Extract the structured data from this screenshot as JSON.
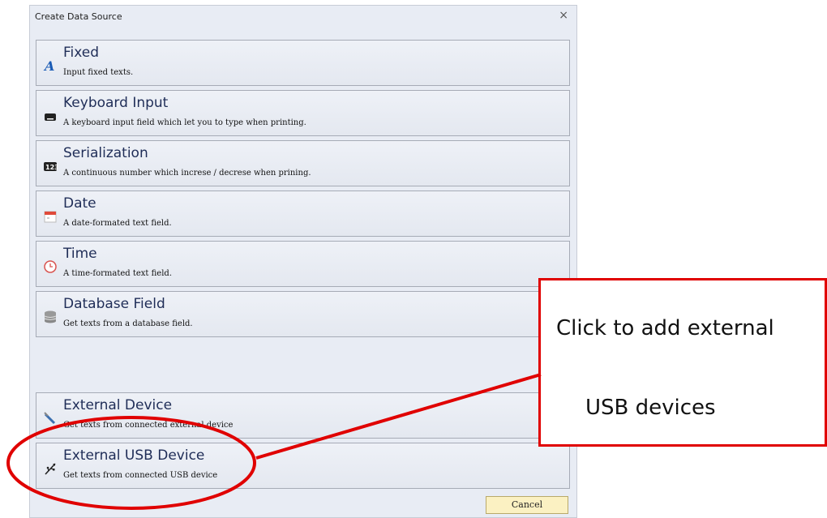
{
  "dialog": {
    "title": "Create Data Source",
    "close_glyph": "×",
    "items": [
      {
        "label": "Fixed",
        "description": "Input fixed texts.",
        "icon": "text-a-icon"
      },
      {
        "label": "Keyboard Input",
        "description": "A keyboard input field which let you to type when printing.",
        "icon": "keyboard-icon"
      },
      {
        "label": "Serialization",
        "description": "A continuous number which increse / decrese when prining.",
        "icon": "serial-number-icon"
      },
      {
        "label": "Date",
        "description": "A date-formated text field.",
        "icon": "calendar-icon"
      },
      {
        "label": "Time",
        "description": "A time-formated text field.",
        "icon": "clock-icon"
      },
      {
        "label": "Database Field",
        "description": "Get texts from a database field.",
        "icon": "database-icon"
      },
      {
        "label": "External Device",
        "description": "Get texts from connected external device",
        "icon": "external-device-icon"
      },
      {
        "label": "External USB Device",
        "description": "Get texts from connected USB device",
        "icon": "usb-icon"
      }
    ],
    "cancel_label": "Cancel"
  },
  "annotation": {
    "line1": "Click to add external",
    "line2": "USB devices",
    "color": "#e00000"
  }
}
